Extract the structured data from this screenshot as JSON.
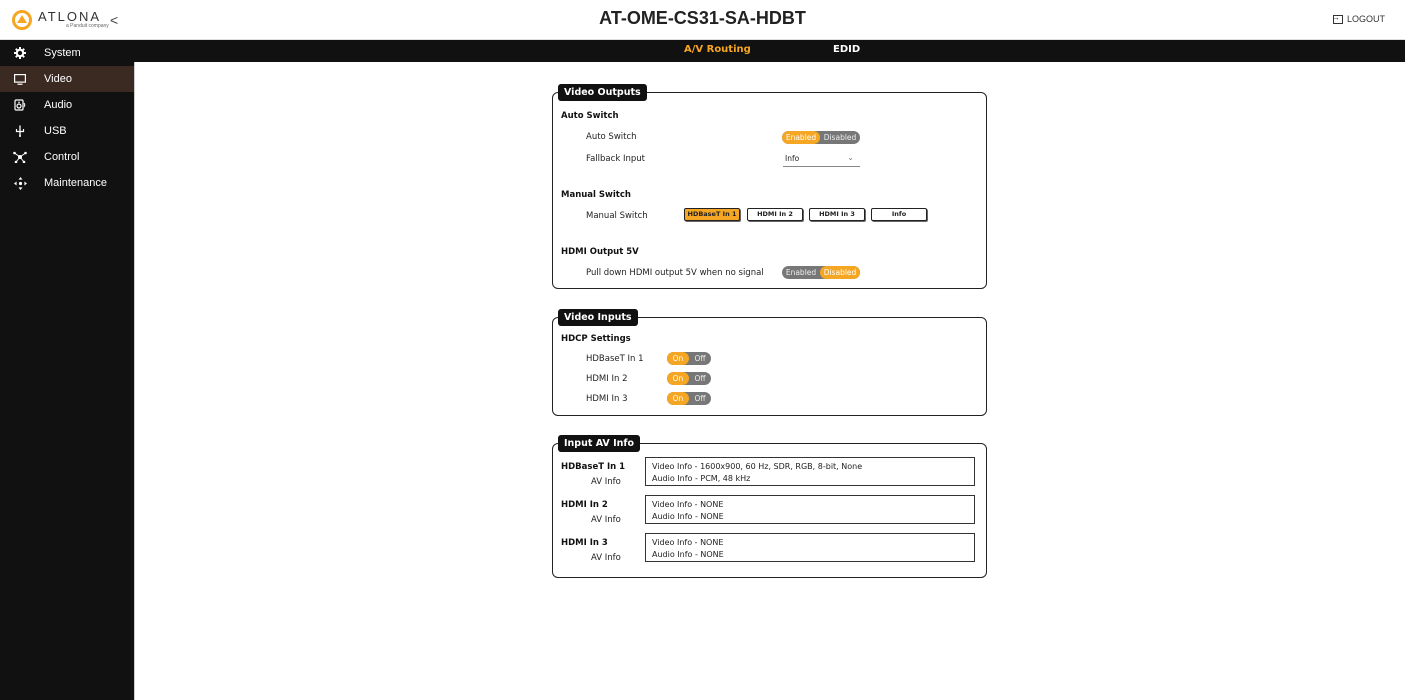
{
  "header": {
    "logo_text": "ATLONA",
    "logo_sub": "a Panduit company",
    "title": "AT-OME-CS31-SA-HDBT",
    "logout_label": "LOGOUT",
    "collapse_glyph": "<"
  },
  "sidebar": {
    "items": [
      {
        "label": "System",
        "icon": "gear-icon"
      },
      {
        "label": "Video",
        "icon": "monitor-icon"
      },
      {
        "label": "Audio",
        "icon": "speaker-icon"
      },
      {
        "label": "USB",
        "icon": "usb-icon"
      },
      {
        "label": "Control",
        "icon": "network-icon"
      },
      {
        "label": "Maintenance",
        "icon": "arrows-icon"
      }
    ],
    "active": "Video"
  },
  "tabs": {
    "routing": "A/V Routing",
    "edid": "EDID",
    "active": "A/V Routing"
  },
  "video_outputs": {
    "title": "Video Outputs",
    "auto_switch_heading": "Auto Switch",
    "auto_switch_label": "Auto Switch",
    "auto_switch_on": "Enabled",
    "auto_switch_off": "Disabled",
    "auto_switch_state": "Enabled",
    "fallback_label": "Fallback Input",
    "fallback_value": "Info",
    "manual_switch_heading": "Manual Switch",
    "manual_switch_label": "Manual Switch",
    "manual_buttons": [
      "HDBaseT In 1",
      "HDMI In 2",
      "HDMI In 3",
      "Info"
    ],
    "manual_selected": "HDBaseT In 1",
    "hdmi5v_heading": "HDMI Output 5V",
    "hdmi5v_label": "Pull down HDMI output 5V when no signal",
    "hdmi5v_on": "Enabled",
    "hdmi5v_off": "Disabled",
    "hdmi5v_state": "Disabled"
  },
  "video_inputs": {
    "title": "Video Inputs",
    "hdcp_heading": "HDCP Settings",
    "on_label": "On",
    "off_label": "Off",
    "inputs": [
      {
        "label": "HDBaseT In 1",
        "state": "On"
      },
      {
        "label": "HDMI In 2",
        "state": "On"
      },
      {
        "label": "HDMI In 3",
        "state": "On"
      }
    ]
  },
  "input_av_info": {
    "title": "Input AV Info",
    "sub_label": "AV Info",
    "inputs": [
      {
        "name": "HDBaseT In 1",
        "video": "Video Info - 1600x900, 60 Hz, SDR, RGB, 8-bit, None",
        "audio": "Audio Info - PCM, 48 kHz"
      },
      {
        "name": "HDMI In 2",
        "video": "Video Info - NONE",
        "audio": "Audio Info - NONE"
      },
      {
        "name": "HDMI In 3",
        "video": "Video Info - NONE",
        "audio": "Audio Info - NONE"
      }
    ]
  },
  "colors": {
    "accent": "#f5a623",
    "sidebar_bg": "#111111",
    "sidebar_active": "#3a2a22"
  }
}
